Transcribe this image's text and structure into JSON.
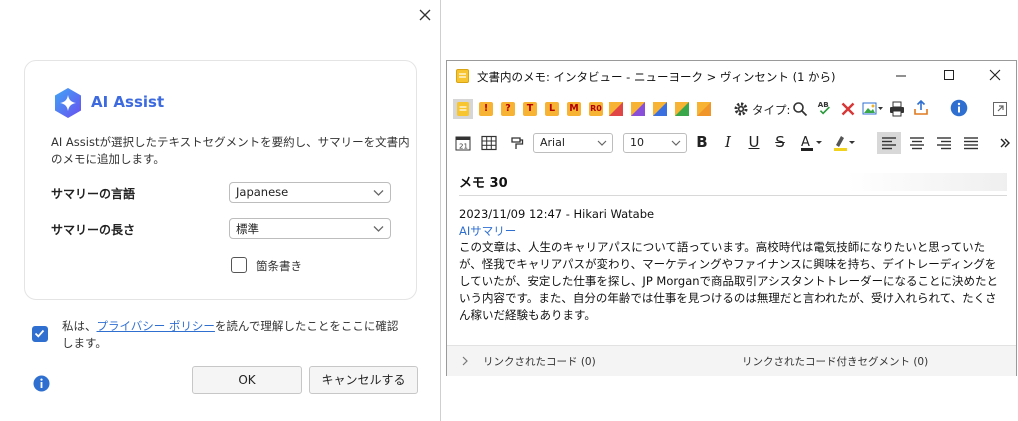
{
  "dialog": {
    "title": "AI Assist",
    "description": "AI Assistが選択したテキストセグメントを要約し、サマリーを文書内のメモに追加します。",
    "summary_language_label": "サマリーの言語",
    "summary_language_value": "Japanese",
    "summary_length_label": "サマリーの長さ",
    "summary_length_value": "標準",
    "bullets_label": "箇条書き",
    "bullets_checked": false,
    "consent_prefix": "私は、",
    "consent_link": "プライバシー ポリシー",
    "consent_suffix": "を読んで理解したことをここに確認します。",
    "consent_checked": true,
    "ok_label": "OK",
    "cancel_label": "キャンセルする",
    "accent_color": "#2f6fd0"
  },
  "memo_window": {
    "title": "文書内のメモ: インタビュー - ニューヨーク > ヴィンセント (1 から)",
    "type_label": "タイプ:",
    "font_family": "Arial",
    "font_size": "10",
    "highlight_badges": [
      "!",
      "?",
      "T",
      "L",
      "M",
      "R0"
    ],
    "heading": "メモ 30",
    "meta": "2023/11/09 12:47 - Hikari Watabe",
    "ai_label": "AIサマリー",
    "body": "この文章は、人生のキャリアパスについて語っています。高校時代は電気技師になりたいと思っていたが、怪我でキャリアパスが変わり、マーケティングやファイナンスに興味を持ち、デイトレーディングをしていたが、安定した仕事を探し、JP Morganで商品取引アシスタントトレーダーになることに決めたという内容です。また、自分の年齢では仕事を見つけるのは無理だと言われたが、受け入れられて、たくさん稼いだ経験もあります。",
    "footer_linked_codes": "リンクされたコード (0)",
    "footer_linked_segments": "リンクされたコード付きセグメント (0)"
  }
}
